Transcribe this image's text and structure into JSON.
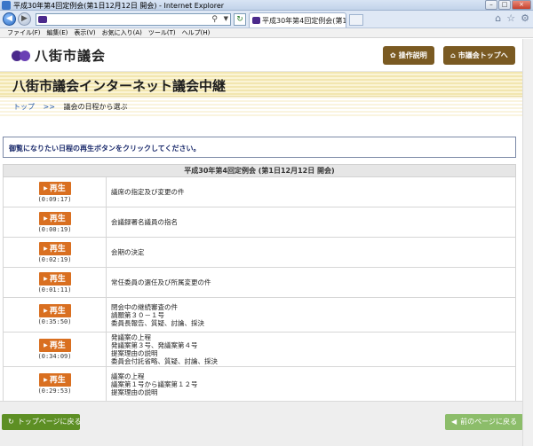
{
  "window": {
    "title": "平成30年第4回定例会(第1日12月12日 開会) - Internet Explorer",
    "tab_title": "平成30年第4回定例会(第1...",
    "controls": [
      "–",
      "□",
      "×"
    ]
  },
  "menu": [
    "ファイル(F)",
    "編集(E)",
    "表示(V)",
    "お気に入り(A)",
    "ツール(T)",
    "ヘルプ(H)"
  ],
  "header": {
    "logo_text": "八街市議会",
    "manual_button": "操作説明",
    "top_button": "市議会トップへ",
    "brand_color": "#4b2a8c",
    "button_color": "#7a5a22"
  },
  "banner": {
    "title": "八街市議会インターネット議会中継"
  },
  "breadcrumb": {
    "home": "トップ",
    "sep": ">>",
    "current": "議会の日程から選ぶ"
  },
  "instruction": "御覧になりたい日程の再生ボタンをクリックしてください。",
  "session": {
    "title": "平成30年第4回定例会 (第1日12月12日 開会)",
    "play_label": "再生",
    "items": [
      {
        "duration": "(0:09:17)",
        "lines": [
          "議席の指定及び変更の件"
        ]
      },
      {
        "duration": "(0:00:19)",
        "lines": [
          "会議録署名議員の指名"
        ]
      },
      {
        "duration": "(0:02:19)",
        "lines": [
          "会期の決定"
        ]
      },
      {
        "duration": "(0:01:11)",
        "lines": [
          "常任委員の選任及び所属変更の件"
        ]
      },
      {
        "duration": "(0:35:50)",
        "lines": [
          "閉会中の継続審査の件",
          "請願第３０－１号",
          "委員長報告、質疑、討論、採決"
        ]
      },
      {
        "duration": "(0:34:09)",
        "lines": [
          "発議案の上程",
          "発議案第３号、発議案第４号",
          "提案理由の説明",
          "委員会付託省略、質疑、討論、採決"
        ]
      },
      {
        "duration": "(0:29:53)",
        "lines": [
          "議案の上程",
          "議案第１号から議案第１２号",
          "提案理由の説明"
        ]
      }
    ]
  },
  "footer": {
    "home_button": "トップページに戻る",
    "back_button": "前のページに戻る"
  }
}
